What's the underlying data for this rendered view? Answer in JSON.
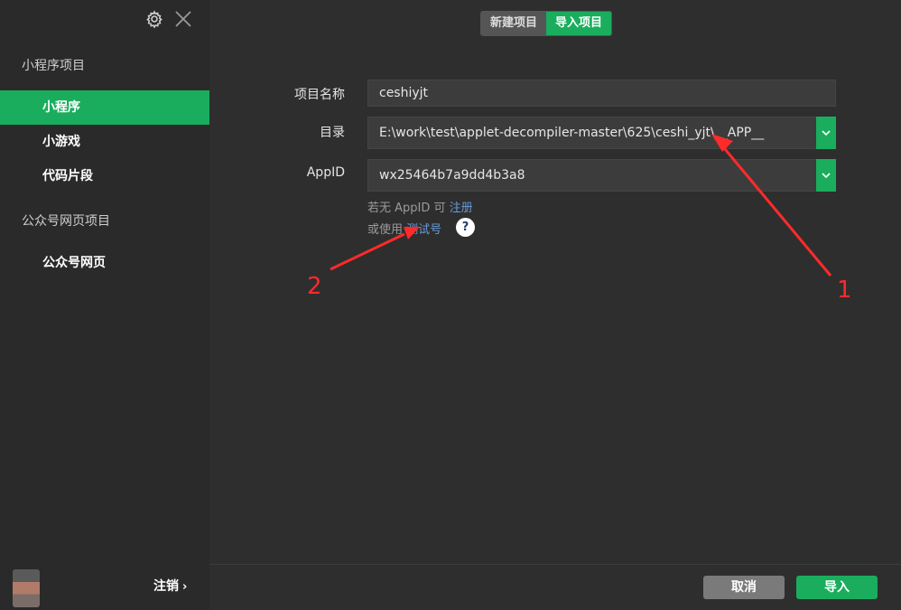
{
  "sidebar": {
    "groups": [
      {
        "title": "小程序项目"
      },
      {
        "title": "公众号网页项目"
      }
    ],
    "items": [
      {
        "label": "小程序"
      },
      {
        "label": "小游戏"
      },
      {
        "label": "代码片段"
      },
      {
        "label": "公众号网页"
      }
    ],
    "logout_label": "注销",
    "logout_chevron": "›"
  },
  "header": {
    "tabs": [
      {
        "label": "新建项目",
        "active": false
      },
      {
        "label": "导入项目",
        "active": true
      }
    ]
  },
  "form": {
    "name_label": "项目名称",
    "name_value": "ceshiyjt",
    "dir_label": "目录",
    "dir_value": "E:\\work\\test\\applet-decompiler-master\\625\\ceshi_yjt\\__APP__",
    "appid_label": "AppID",
    "appid_value": "wx25464b7a9dd4b3a8",
    "hint1_prefix": "若无 AppID 可 ",
    "hint1_link": "注册",
    "hint2_prefix": "或使用 ",
    "hint2_link": "测试号",
    "help_glyph": "?"
  },
  "footer": {
    "cancel_label": "取消",
    "import_label": "导入"
  },
  "annotations": {
    "label1": "1",
    "label2": "2",
    "color": "#ff2a2a"
  },
  "colors": {
    "accent": "#1aad5d",
    "background": "#2e2e2e",
    "sidebar": "#2a2a2a",
    "link": "#6a9bd8"
  }
}
